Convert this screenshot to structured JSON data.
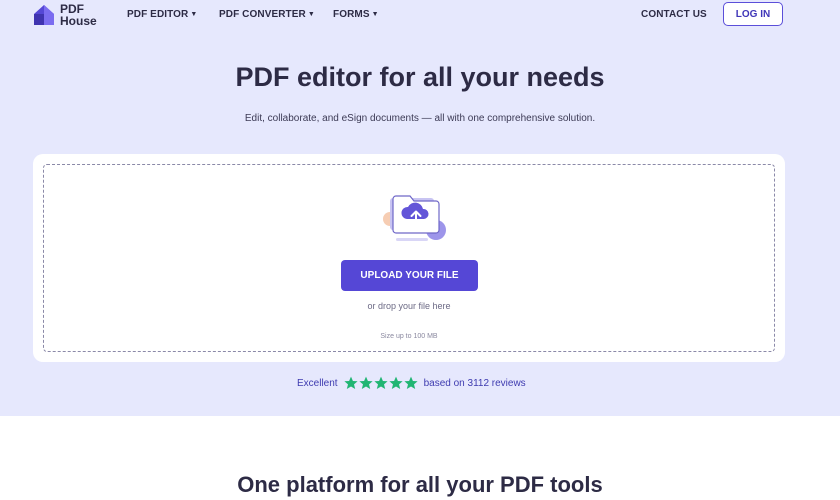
{
  "brand": {
    "line1": "PDF",
    "line2": "House",
    "accent": "#5547d6"
  },
  "nav": {
    "items": [
      {
        "label": "PDF EDITOR",
        "has_caret": true
      },
      {
        "label": "PDF CONVERTER",
        "has_caret": true
      },
      {
        "label": "FORMS",
        "has_caret": true
      }
    ],
    "contact": "CONTACT US",
    "login": "LOG IN",
    "caret_icon": "triangle-down"
  },
  "hero": {
    "title": "PDF editor for all your needs",
    "subtitle": "Edit, collaborate, and eSign documents — all with one comprehensive solution.",
    "background": "#e6e8fd"
  },
  "upload": {
    "illustration_icon": "folder-cloud-upload-icon",
    "button_label": "UPLOAD YOUR FILE",
    "drop_text": "or drop your file here",
    "size_text": "Size up to 100 MB"
  },
  "rating": {
    "label": "Excellent",
    "stars": 5,
    "star_color": "#21b573",
    "reviews_text": "based on 3112 reviews"
  },
  "section": {
    "title": "One platform for all your PDF tools"
  }
}
